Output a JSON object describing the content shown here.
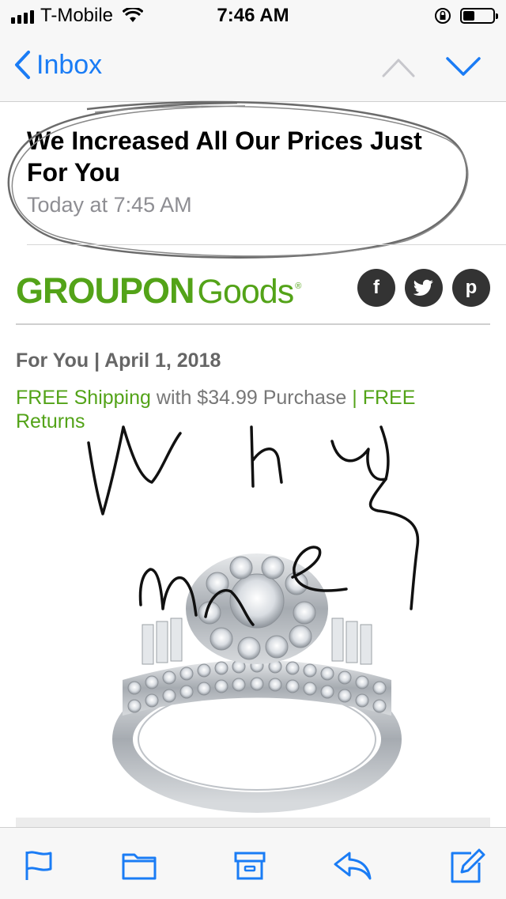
{
  "status_bar": {
    "carrier": "T-Mobile",
    "time": "7:46 AM"
  },
  "nav": {
    "back_label": "Inbox"
  },
  "message": {
    "subject": "We Increased All Our Prices Just For You",
    "date": "Today at 7:45 AM"
  },
  "email_body": {
    "logo_primary": "GROUPON",
    "logo_secondary": "Goods",
    "logo_mark": "®",
    "social": [
      "f",
      "t",
      "p"
    ],
    "dateline": "For You | April 1, 2018",
    "shipping_part1": "FREE Shipping",
    "shipping_part2": " with $34.99 Purchase ",
    "shipping_part3": "| FREE Returns"
  },
  "handwritten_note": "Why me?",
  "colors": {
    "ios_blue": "#1a7cf5",
    "groupon_green": "#53a318"
  },
  "toolbar_icons": [
    "flag-icon",
    "folder-icon",
    "archive-icon",
    "reply-icon",
    "compose-icon"
  ]
}
